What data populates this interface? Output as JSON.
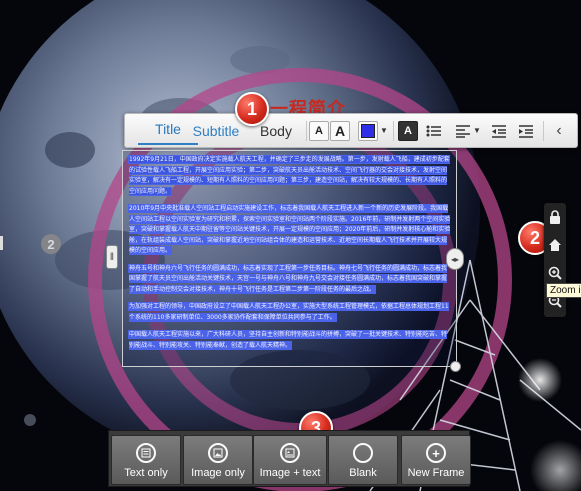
{
  "callouts": {
    "c1": "1",
    "c2": "2",
    "c3": "3"
  },
  "overlay_red_title": "一程简介",
  "page_indicator": "2",
  "toolbar": {
    "tab_title": "Title",
    "tab_subtitle": "Subtitle",
    "tab_body": "Body",
    "font_smaller": "A",
    "font_larger": "A",
    "color_swatch": "#2e2ee6",
    "text_bg": "A",
    "list_icon": "bulleted-list-icon",
    "align_icon": "align-left-icon",
    "outdent_icon": "outdent-icon",
    "indent_icon": "indent-icon",
    "collapse_icon": "chevron-left-icon"
  },
  "textbox": {
    "paragraphs": [
      "1992年9月21日，中国政府决定实施载人航天工程，并确定了三步走的发展战略。第一步，发射载人飞船，建成初步配套的试验性载人飞船工程，开展空间应用实验；第二步，突破航天员出舱活动技术、空间飞行器的交会对接技术，发射空间实验室，解决有一定规模的、短期有人照料的空间应用问题；第三步，建造空间站，解决有较大规模的、长期有人照料的空间应用问题。",
      "2010年9月中央批准载人空间站工程启动实施建设工作，标志着我国载人航天工程进入新一个新的历史发展阶段。我国载人空间站工程以空间实验室为研究和积累，探索空间实验室和空间站两个阶段实施。2016年前，研制并发射两个空间实验室，突破和掌握载人航天中期驻留等空间站关键技术，开展一定规模的空间应用；2020年前后，研制并发射核心舱和实验舱，在轨组装成载人空间站，突破和掌握近地空间站组合体的建造和运营技术、近地空间长期载人飞行技术并开展较大规模的空间应用。",
      "神舟五号和神舟六号飞行任务的圆满成功，标志着实现了工程第一步任务目标。神舟七号飞行任务的圆满成功，标志着我国掌握了航天员空间出舱活动关键技术，天宫一号与神舟八号和神舟九号交会对接任务圆满成功，标志着我国突破和掌握了自动和手动控制交会对接技术，神舟十号飞行任务是工程第二步第一阶段任务的最后之战。",
      "为加强对工程的领导，中国政府设立了中国载人航天工程办公室，实施大型系统工程管理模式，依据工程总体规划工程11个系统的110多家研制单位、3000多家协作配套和保障单位共同参与了工作。",
      "中国载人航天工程实施以来，广大科研人员，坚持自主创新和特别能战斗的拼搏，突破了一批关键技术、特别能吃苦、特别能战斗、特别能攻关、特别能奉献，创造了载人航天精神。"
    ]
  },
  "right_toolbar": {
    "lock_icon": "lock-icon",
    "home_icon": "home-icon",
    "zoom_in_icon": "zoom-in-icon",
    "zoom_out_icon": "zoom-out-icon",
    "tooltip": "Zoom i"
  },
  "layouts": [
    {
      "label": "Text only",
      "icon": "text-only-icon"
    },
    {
      "label": "Image only",
      "icon": "image-only-icon"
    },
    {
      "label": "Image + text",
      "icon": "image-text-icon"
    },
    {
      "label": "Blank",
      "icon": "blank-icon"
    },
    {
      "label": "New Frame",
      "icon": "new-frame-plus-icon"
    }
  ],
  "colors": {
    "highlight": "#4a63e8",
    "ring": "#b4458a",
    "callout_red": "#d52b1e"
  }
}
